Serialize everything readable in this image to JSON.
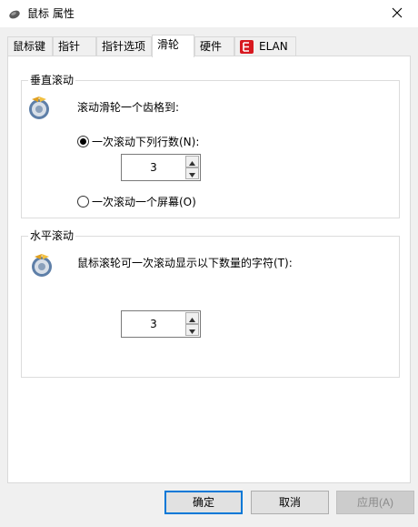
{
  "window": {
    "title": "鼠标 属性",
    "close_glyph": "✕"
  },
  "tabs": [
    {
      "label": "鼠标键",
      "active": false
    },
    {
      "label": "指针",
      "active": false
    },
    {
      "label": "指针选项",
      "active": false
    },
    {
      "label": "滑轮",
      "active": true
    },
    {
      "label": "硬件",
      "active": false
    },
    {
      "label": "ELAN",
      "active": false
    }
  ],
  "vertical_scroll": {
    "title": "垂直滚动",
    "description": "滚动滑轮一个齿格到:",
    "option_lines": {
      "label": "一次滚动下列行数(N):",
      "selected": true
    },
    "lines_value": "3",
    "option_screen": {
      "label": "一次滚动一个屏幕(O)",
      "selected": false
    }
  },
  "horizontal_scroll": {
    "title": "水平滚动",
    "description": "鼠标滚轮可一次滚动显示以下数量的字符(T):",
    "chars_value": "3"
  },
  "buttons": {
    "ok": "确定",
    "cancel": "取消",
    "apply": "应用(A)"
  },
  "colors": {
    "accent": "#0078d7",
    "elan_brand": "#d71920"
  }
}
